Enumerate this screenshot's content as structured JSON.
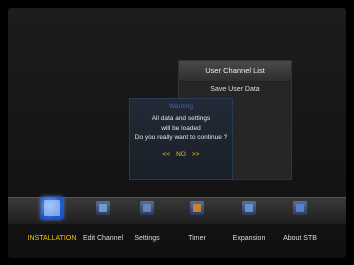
{
  "panel": {
    "title": "User Channel List",
    "items": [
      "Save User Data",
      "",
      ""
    ]
  },
  "dialog": {
    "title": "Warning",
    "lines": [
      "All data and settings",
      "will be loaded",
      "Do you really want to continue ?"
    ],
    "prev_arrow": "<<",
    "choice": "NO",
    "next_arrow": ">>"
  },
  "menu": {
    "items": [
      {
        "label": "INSTALLATION",
        "icon": "installation-icon",
        "active": true
      },
      {
        "label": "Edit Channel",
        "icon": "edit-channel-icon",
        "active": false
      },
      {
        "label": "Settings",
        "icon": "settings-icon",
        "active": false
      },
      {
        "label": "Timer",
        "icon": "timer-icon",
        "active": false
      },
      {
        "label": "Expansion",
        "icon": "expansion-icon",
        "active": false
      },
      {
        "label": "About STB",
        "icon": "about-stb-icon",
        "active": false
      }
    ]
  },
  "colors": {
    "active_label": "#f2c600",
    "choice": "#e5c21a",
    "accent_blue": "#1a55c9"
  }
}
